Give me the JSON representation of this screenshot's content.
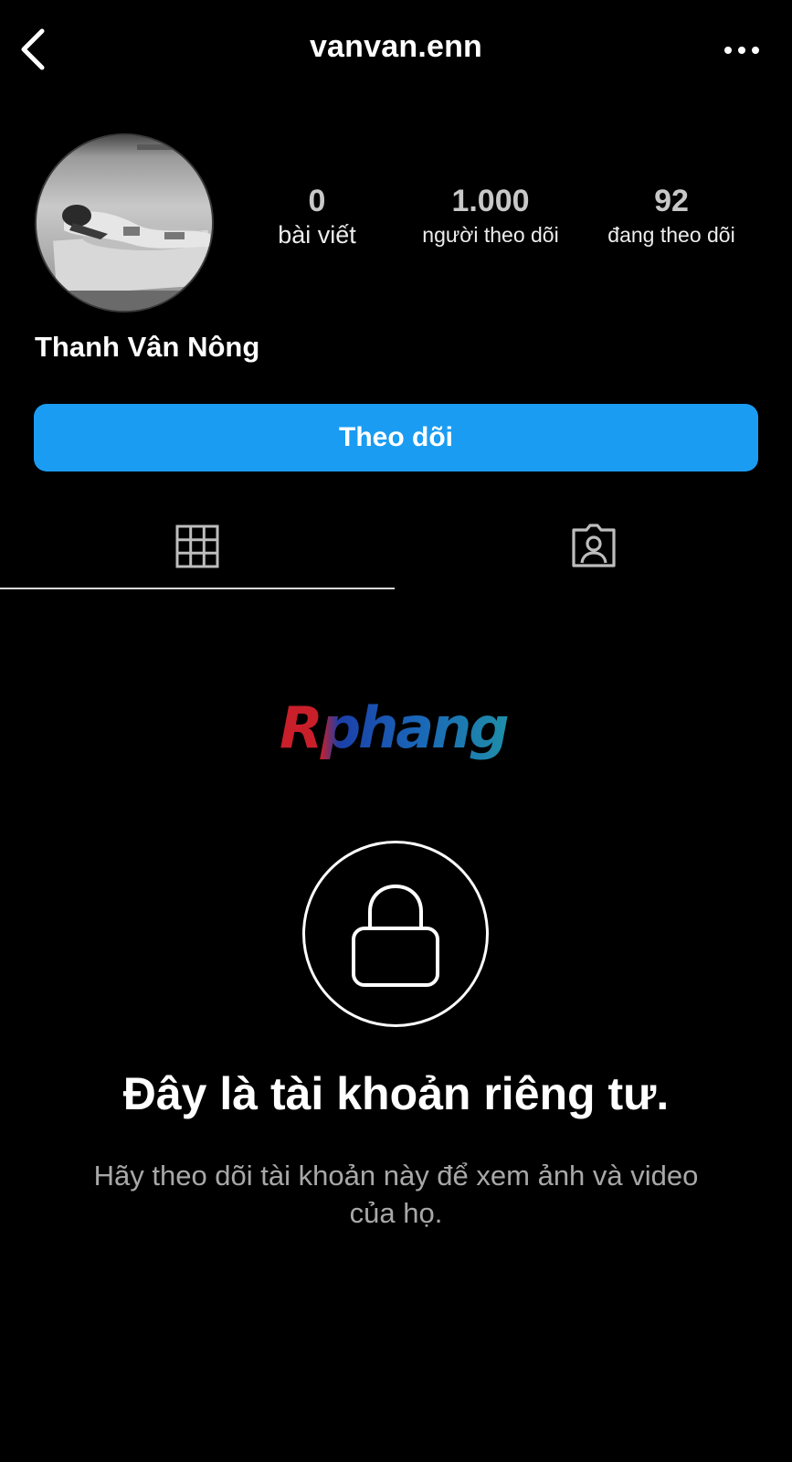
{
  "header": {
    "username": "vanvan.enn",
    "back_icon": "chevron-left-icon",
    "more_icon": "more-horizontal-icon"
  },
  "profile": {
    "display_name": "Thanh Vân Nông",
    "stats": [
      {
        "value": "0",
        "label": "bài viết"
      },
      {
        "value": "1.000",
        "label": "người theo dõi"
      },
      {
        "value": "92",
        "label": "đang theo dõi"
      }
    ]
  },
  "actions": {
    "follow_label": "Theo dõi",
    "follow_color": "#1a9cf2"
  },
  "tabs": [
    {
      "icon": "grid-icon",
      "active": true
    },
    {
      "icon": "tagged-person-icon",
      "active": false
    }
  ],
  "watermark": {
    "text": "Rphang"
  },
  "private_notice": {
    "icon": "lock-icon",
    "title": "Đây là tài khoản riêng tư.",
    "description": "Hãy theo dõi tài khoản này để xem ảnh và video của họ."
  }
}
